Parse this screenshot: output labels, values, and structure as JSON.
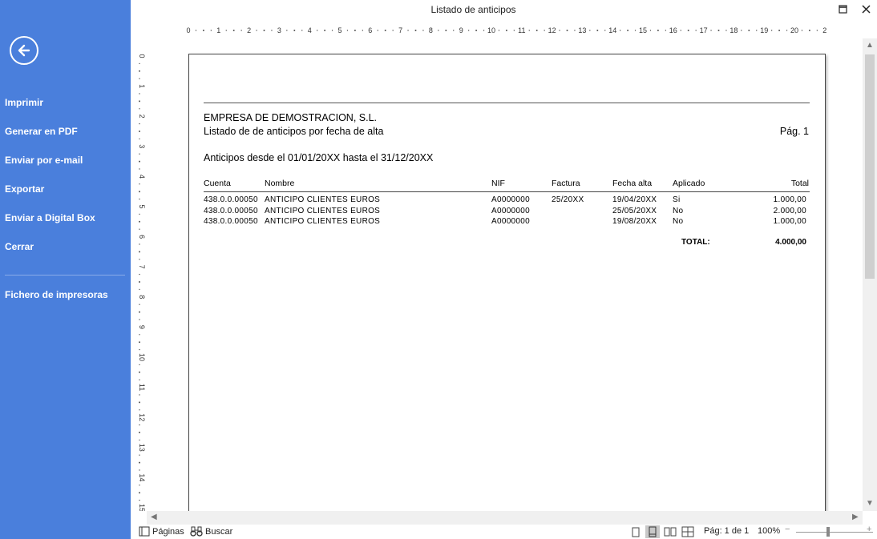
{
  "window": {
    "title": "Listado de anticipos"
  },
  "sidebar": {
    "items": [
      {
        "label": "Imprimir"
      },
      {
        "label": "Generar en PDF"
      },
      {
        "label": "Enviar por e-mail"
      },
      {
        "label": "Exportar"
      },
      {
        "label": "Enviar a Digital Box"
      },
      {
        "label": "Cerrar"
      }
    ],
    "secondary": {
      "label": "Fichero de impresoras"
    }
  },
  "report": {
    "company": "EMPRESA DE DEMOSTRACION, S.L.",
    "subtitle": "Listado de de anticipos por fecha de alta",
    "page": "Pág. 1",
    "range": "Anticipos desde el 01/01/20XX  hasta el 31/12/20XX",
    "columns": {
      "cuenta": "Cuenta",
      "nombre": "Nombre",
      "nif": "NIF",
      "factura": "Factura",
      "fecha": "Fecha alta",
      "aplicado": "Aplicado",
      "total": "Total"
    },
    "rows": [
      {
        "cuenta": "438.0.0.00050",
        "nombre": "ANTICIPO CLIENTES EUROS",
        "nif": "A0000000",
        "factura": "25/20XX",
        "fecha": "19/04/20XX",
        "aplicado": "Si",
        "total": "1.000,00"
      },
      {
        "cuenta": "438.0.0.00050",
        "nombre": "ANTICIPO CLIENTES EUROS",
        "nif": "A0000000",
        "factura": "",
        "fecha": "25/05/20XX",
        "aplicado": "No",
        "total": "2.000,00"
      },
      {
        "cuenta": "438.0.0.00050",
        "nombre": "ANTICIPO CLIENTES EUROS",
        "nif": "A0000000",
        "factura": "",
        "fecha": "19/08/20XX",
        "aplicado": "No",
        "total": "1.000,00"
      }
    ],
    "total_label": "TOTAL:",
    "total_value": "4.000,00"
  },
  "rulers": {
    "horizontal": [
      "0",
      "1",
      "2",
      "3",
      "4",
      "5",
      "6",
      "7",
      "8",
      "9",
      "10",
      "11",
      "12",
      "13",
      "14",
      "15",
      "16",
      "17",
      "18",
      "19",
      "20",
      "2"
    ],
    "vertical": [
      "0",
      "1",
      "2",
      "3",
      "4",
      "5",
      "6",
      "7",
      "8",
      "9",
      "10",
      "11",
      "12",
      "13",
      "14",
      "15"
    ]
  },
  "statusbar": {
    "pages_label": "Páginas",
    "search_label": "Buscar",
    "page_indicator": "Pág: 1 de 1",
    "zoom": "100%"
  },
  "colors": {
    "sidebar": "#4a7fdc"
  },
  "icons": [
    "back-arrow-icon",
    "maximize-icon",
    "close-icon",
    "pages-icon",
    "binoculars-icon",
    "single-page-icon",
    "page-width-icon",
    "two-pages-icon",
    "multi-page-icon",
    "zoom-out-icon",
    "zoom-in-icon"
  ]
}
